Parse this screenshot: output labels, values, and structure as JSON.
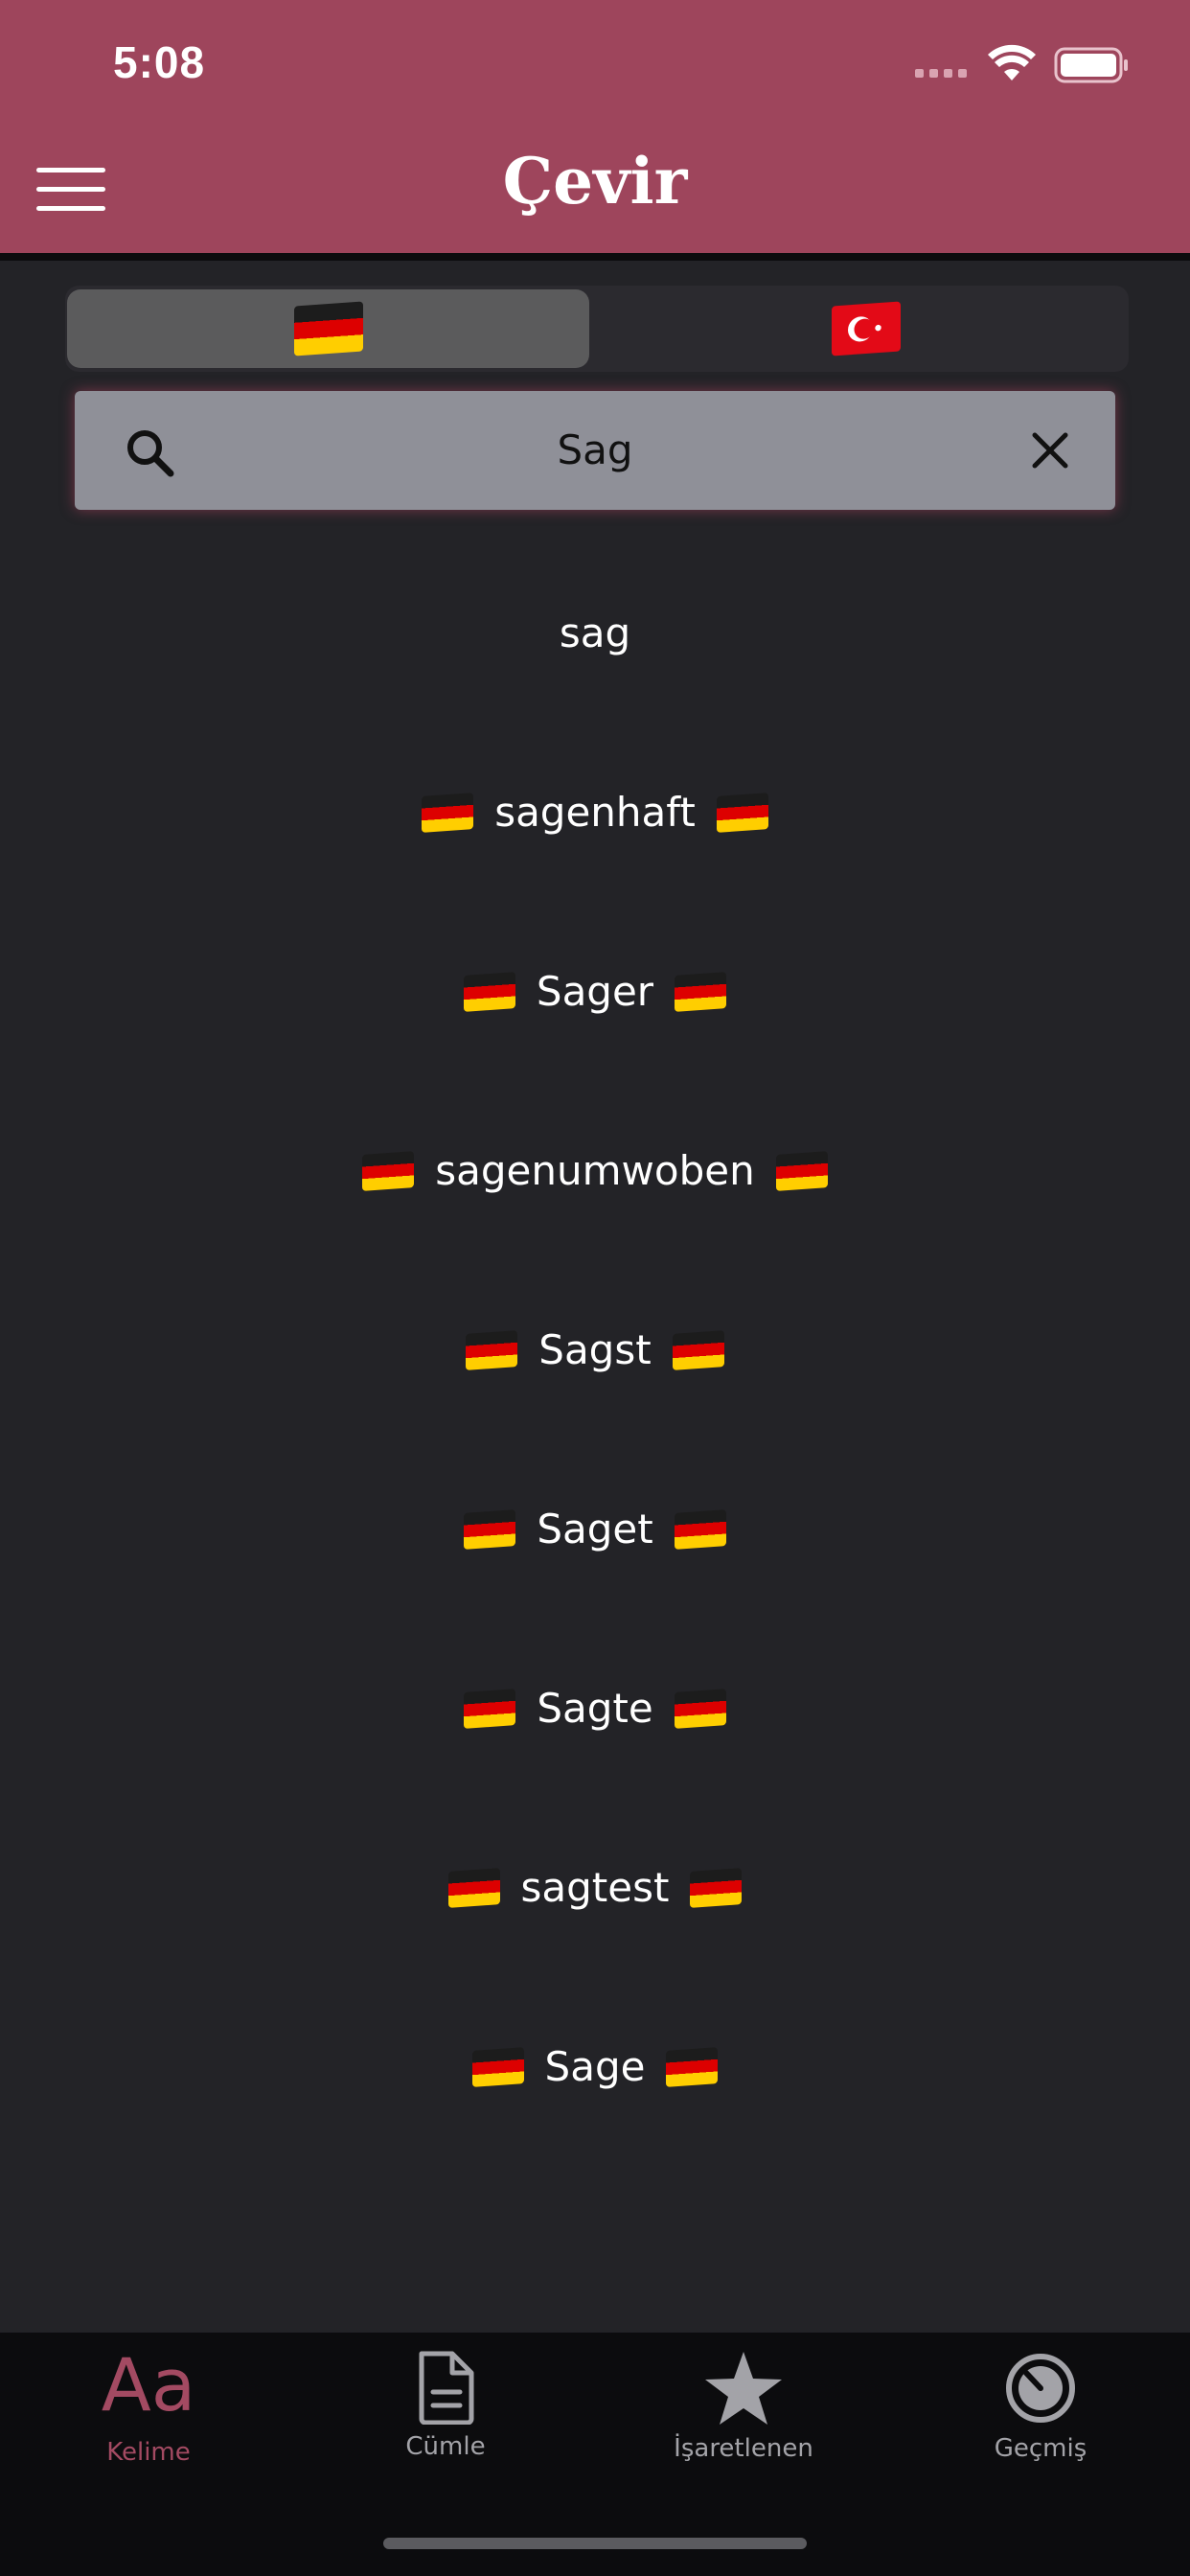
{
  "status": {
    "time": "5:08"
  },
  "header": {
    "title": "Çevir",
    "menu_icon": "hamburger-icon"
  },
  "language_toggle": {
    "source": {
      "flag": "germany-flag",
      "selected": true
    },
    "target": {
      "flag": "turkey-flag",
      "selected": false
    }
  },
  "search": {
    "value": "Sag",
    "icon": "search-icon",
    "clear_icon": "close-icon"
  },
  "results": [
    {
      "text": "sag",
      "flags": false
    },
    {
      "text": "sagenhaft",
      "flags": true
    },
    {
      "text": "Sager",
      "flags": true
    },
    {
      "text": "sagenumwoben",
      "flags": true
    },
    {
      "text": "Sagst",
      "flags": true
    },
    {
      "text": "Saget",
      "flags": true
    },
    {
      "text": "Sagte",
      "flags": true
    },
    {
      "text": "sagtest",
      "flags": true
    },
    {
      "text": "Sage",
      "flags": true
    }
  ],
  "tabbar": {
    "active": "kelime",
    "kelime": {
      "label": "Kelime",
      "glyph": "Aa"
    },
    "cumle": {
      "label": "Cümle",
      "icon": "document-icon"
    },
    "isaretlenen": {
      "label": "İşaretlenen",
      "icon": "star-icon"
    },
    "gecmis": {
      "label": "Geçmiş",
      "icon": "history-icon"
    }
  },
  "colors": {
    "brand": "#9e455c",
    "accent": "#a34a62",
    "background": "#232327"
  }
}
